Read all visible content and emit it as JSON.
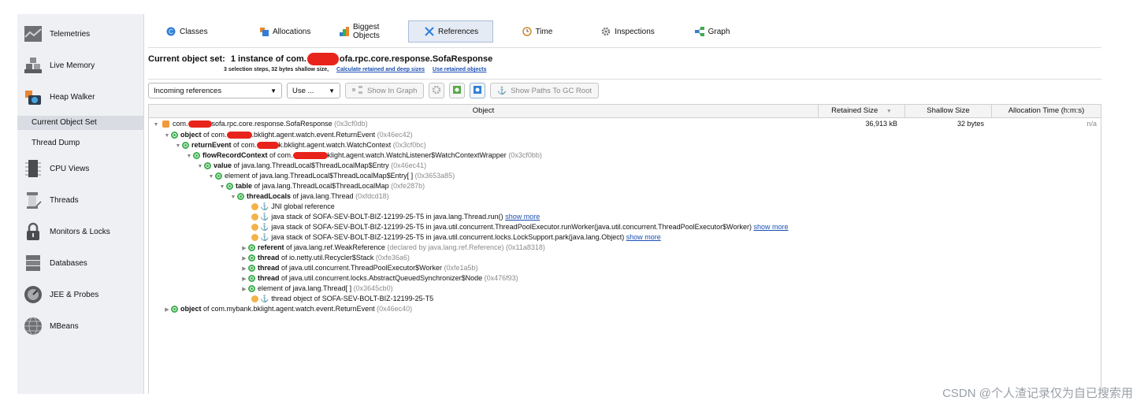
{
  "sidebar": {
    "items": [
      {
        "label": "Telemetries",
        "icon": "telemetries-icon"
      },
      {
        "label": "Live Memory",
        "icon": "live-memory-icon"
      },
      {
        "label": "Heap Walker",
        "icon": "heap-walker-icon"
      },
      {
        "label": "CPU Views",
        "icon": "cpu-views-icon"
      },
      {
        "label": "Threads",
        "icon": "threads-icon"
      },
      {
        "label": "Monitors & Locks",
        "icon": "monitors-locks-icon"
      },
      {
        "label": "Databases",
        "icon": "databases-icon"
      },
      {
        "label": "JEE & Probes",
        "icon": "jee-probes-icon"
      },
      {
        "label": "MBeans",
        "icon": "mbeans-icon"
      }
    ],
    "subitems": [
      {
        "label": "Current Object Set",
        "active": true
      },
      {
        "label": "Thread Dump",
        "active": false
      }
    ]
  },
  "tabs": [
    {
      "label": "Classes",
      "icon": "classes-icon",
      "active": false
    },
    {
      "label": "Allocations",
      "icon": "allocations-icon",
      "active": false
    },
    {
      "label": "Biggest Objects",
      "icon": "biggest-objects-icon",
      "active": false
    },
    {
      "label": "References",
      "icon": "references-icon",
      "active": true
    },
    {
      "label": "Time",
      "icon": "time-icon",
      "active": false
    },
    {
      "label": "Inspections",
      "icon": "inspections-icon",
      "active": false
    },
    {
      "label": "Graph",
      "icon": "graph-icon",
      "active": false
    }
  ],
  "object_set": {
    "title_prefix": "Current object set:",
    "title_main": "1 instance of com.",
    "title_suffix": "ofa.rpc.core.response.SofaResponse",
    "sub_text": "3 selection steps, 32 bytes shallow size,",
    "link_calc": "Calculate retained and deep sizes",
    "link_use": "Use retained objects"
  },
  "controls": {
    "ref_select": "Incoming references",
    "use_select": "Use ...",
    "show_graph": "Show In Graph",
    "show_paths": "Show Paths To GC Root"
  },
  "grid": {
    "columns": {
      "object": "Object",
      "retained": "Retained Size",
      "shallow": "Shallow Size",
      "alloc_time": "Allocation Time (h:m:s)"
    },
    "root_row": {
      "pre": "com.",
      "post": "sofa.rpc.core.response.SofaResponse",
      "id": "(0x3cf0db)",
      "retained": "36,913 kB",
      "shallow": "32 bytes",
      "alloc_time": "n/a"
    }
  },
  "rows": {
    "r1": {
      "bold": "object",
      "pre": " of com.",
      "post": ".bklight.agent.watch.event.ReturnEvent ",
      "id": "(0x46ec42)"
    },
    "r2": {
      "bold": "returnEvent",
      "pre": " of com.",
      "post": "k.bklight.agent.watch.WatchContext ",
      "id": "(0x3cf0bc)"
    },
    "r3": {
      "bold": "flowRecordContext",
      "pre": " of com.",
      "post": "klight.agent.watch.WatchListener$WatchContextWrapper ",
      "id": "(0x3cf0bb)"
    },
    "r4": {
      "bold": "value",
      "text": " of java.lang.ThreadLocal$ThreadLocalMap$Entry ",
      "id": "(0x46ec41)"
    },
    "r5": {
      "text": "element of java.lang.ThreadLocal$ThreadLocalMap$Entry[ ] ",
      "id": "(0x3653a85)"
    },
    "r6": {
      "bold": "table",
      "text": " of java.lang.ThreadLocal$ThreadLocalMap ",
      "id": "(0xfe287b)"
    },
    "r7": {
      "bold": "threadLocals",
      "text": " of java.lang.Thread ",
      "id": "(0xfdcd18)"
    },
    "r8": {
      "text": "JNI global reference"
    },
    "r9": {
      "text": "java stack of SOFA-SEV-BOLT-BIZ-12199-25-T5 in java.lang.Thread.run() ",
      "link": "show more"
    },
    "r10": {
      "text": "java stack of SOFA-SEV-BOLT-BIZ-12199-25-T5 in java.util.concurrent.ThreadPoolExecutor.runWorker(java.util.concurrent.ThreadPoolExecutor$Worker) ",
      "link": "show more"
    },
    "r11": {
      "text": "java stack of SOFA-SEV-BOLT-BIZ-12199-25-T5 in java.util.concurrent.locks.LockSupport.park(java.lang.Object) ",
      "link": "show more"
    },
    "r12": {
      "bold": "referent",
      "text": " of java.lang.ref.WeakReference ",
      "id": "(declared by java.lang.ref.Reference) (0x11a8318)"
    },
    "r13": {
      "bold": "thread",
      "text": " of io.netty.util.Recycler$Stack ",
      "id": "(0xfe36a6)"
    },
    "r14": {
      "bold": "thread",
      "text": " of java.util.concurrent.ThreadPoolExecutor$Worker ",
      "id": "(0xfe1a5b)"
    },
    "r15": {
      "bold": "thread",
      "text": " of java.util.concurrent.locks.AbstractQueuedSynchronizer$Node ",
      "id": "(0x476f93)"
    },
    "r16": {
      "text": "element of java.lang.Thread[ ] ",
      "id": "(0x3645cb0)"
    },
    "r17": {
      "text": "thread object of SOFA-SEV-BOLT-BIZ-12199-25-T5"
    },
    "r18": {
      "bold": "object",
      "text": " of com.mybank.bklight.agent.watch.event.ReturnEvent ",
      "id": "(0x46ec40)"
    }
  },
  "watermark": "CSDN @个人渣记录仅为自已搜索用"
}
